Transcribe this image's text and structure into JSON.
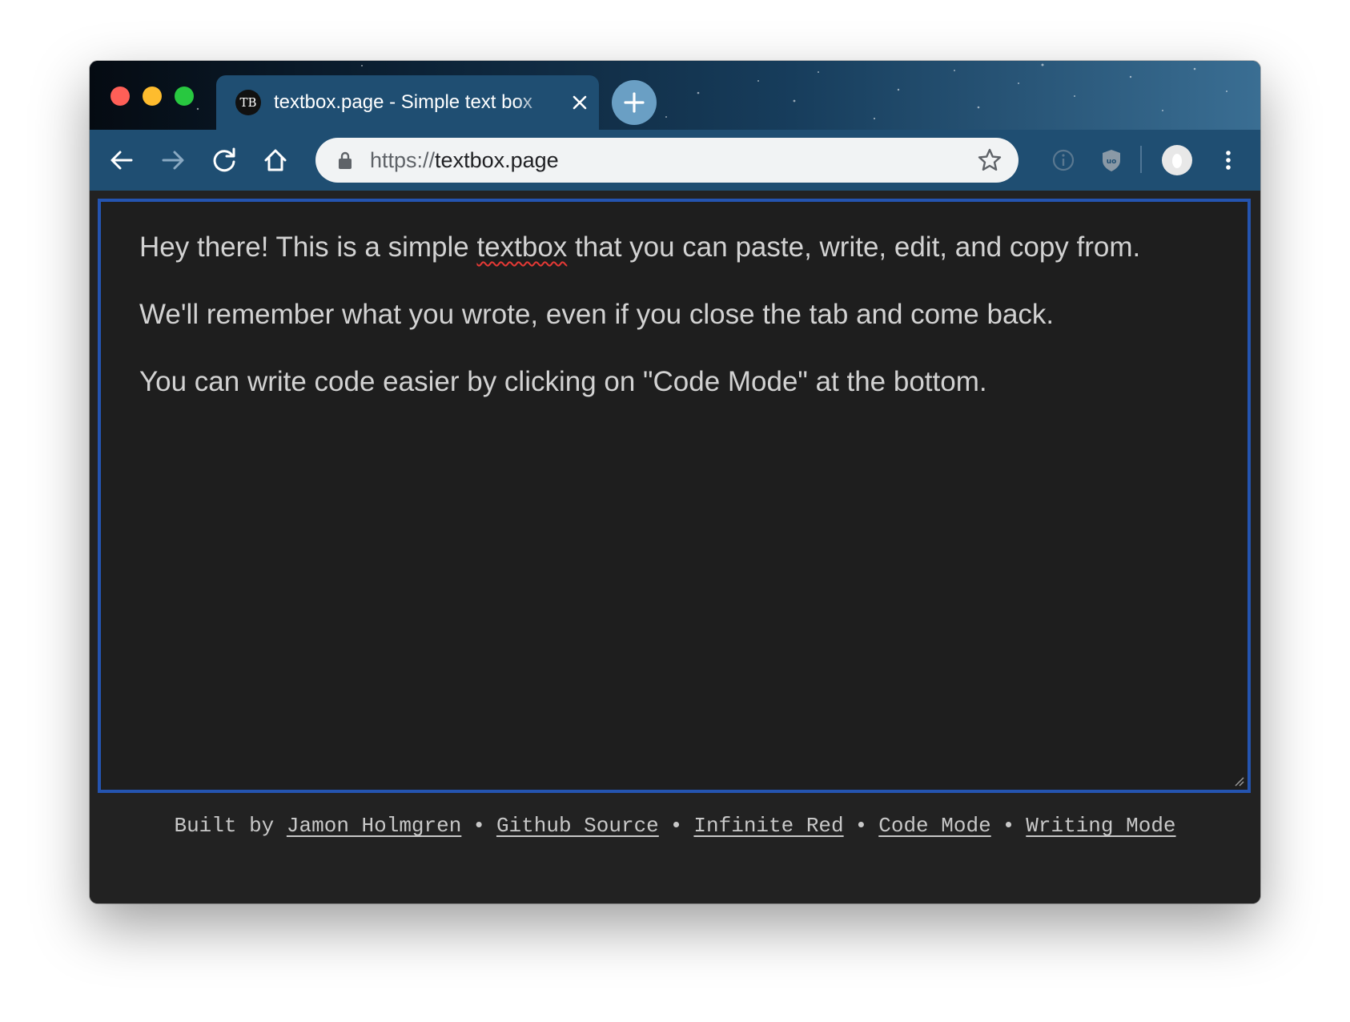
{
  "window": {
    "tab": {
      "favicon_text": "TB",
      "title": "textbox.page - Simple text box",
      "close_icon": "close-icon"
    },
    "new_tab_icon": "plus-icon"
  },
  "toolbar": {
    "url_scheme": "https://",
    "url_host": "textbox.page",
    "icons": [
      "back-arrow-icon",
      "forward-arrow-icon",
      "reload-icon",
      "home-icon",
      "lock-icon",
      "bookmark-star-icon",
      "info-extension-icon",
      "ublock-shield-icon",
      "profile-avatar-icon",
      "menu-dots-icon"
    ]
  },
  "editor": {
    "line1_before": "Hey there! This is a simple ",
    "line1_misspelled": "textbox",
    "line1_after": " that you can paste, write, edit, and copy from.",
    "line2": "We'll remember what you wrote, even if you close the tab and come back.",
    "line3": "You can write code easier by clicking on \"Code Mode\" at the bottom."
  },
  "footer": {
    "built_by": "Built by",
    "separator": "•",
    "links": {
      "author": "Jamon Holmgren",
      "github": "Github Source",
      "company": "Infinite Red",
      "code_mode": "Code Mode",
      "writing_mode": "Writing Mode"
    }
  },
  "colors": {
    "tab_bar_accent": "#1f4e72",
    "editor_background": "#1e1e1e",
    "editor_border": "#2454b0",
    "text": "#d2d2d2"
  }
}
